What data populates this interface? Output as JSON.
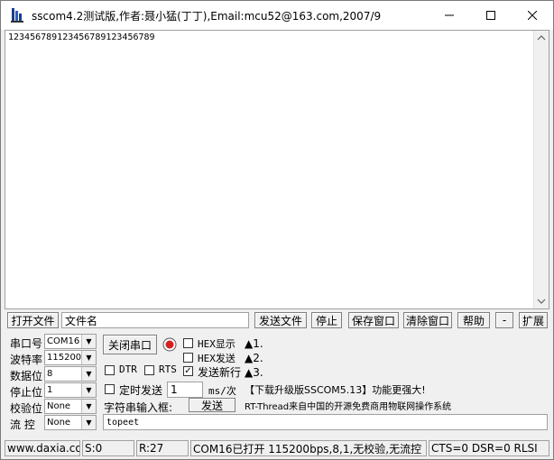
{
  "window": {
    "title": "sscom4.2测试版,作者:聂小猛(丁丁),Email:mcu52@163.com,2007/9"
  },
  "receive": {
    "text": "123456789123456789123456789"
  },
  "toolbar": {
    "open_file": "打开文件",
    "filename": "文件名",
    "send_file": "发送文件",
    "stop": "停止",
    "save_window": "保存窗口",
    "clear_window": "清除窗口",
    "help": "帮助",
    "minus": "-",
    "expand": "扩展"
  },
  "settings": {
    "port_label": "串口号",
    "port_value": "COM16",
    "baud_label": "波特率",
    "baud_value": "115200",
    "databits_label": "数据位",
    "databits_value": "8",
    "stopbits_label": "停止位",
    "stopbits_value": "1",
    "parity_label": "校验位",
    "parity_value": "None",
    "flow_label": "流 控",
    "flow_value": "None"
  },
  "controls": {
    "close_port": "关闭串口",
    "hex_display": "HEX显示",
    "hex_send": "HEX发送",
    "send_newline": "发送新行",
    "dtr": "DTR",
    "rts": "RTS",
    "timed_send": "定时发送",
    "interval_value": "1",
    "interval_unit": "ms/次",
    "input_label": "字符串输入框:",
    "send": "发送",
    "input_value": "topeet"
  },
  "info": {
    "line1": "▲1.",
    "line2": "▲2.",
    "line3": "▲3.",
    "promo": "【下载升级版SSCOM5.13】功能更强大!",
    "promo2": "RT-Thread来自中国的开源免费商用物联网操作系统"
  },
  "status": {
    "site": "www.daxia.cor",
    "sent": "S:0",
    "received": "R:27",
    "port_state": "COM16已打开  115200bps,8,1,无校验,无流控",
    "signals": "CTS=0 DSR=0 RLSI"
  }
}
